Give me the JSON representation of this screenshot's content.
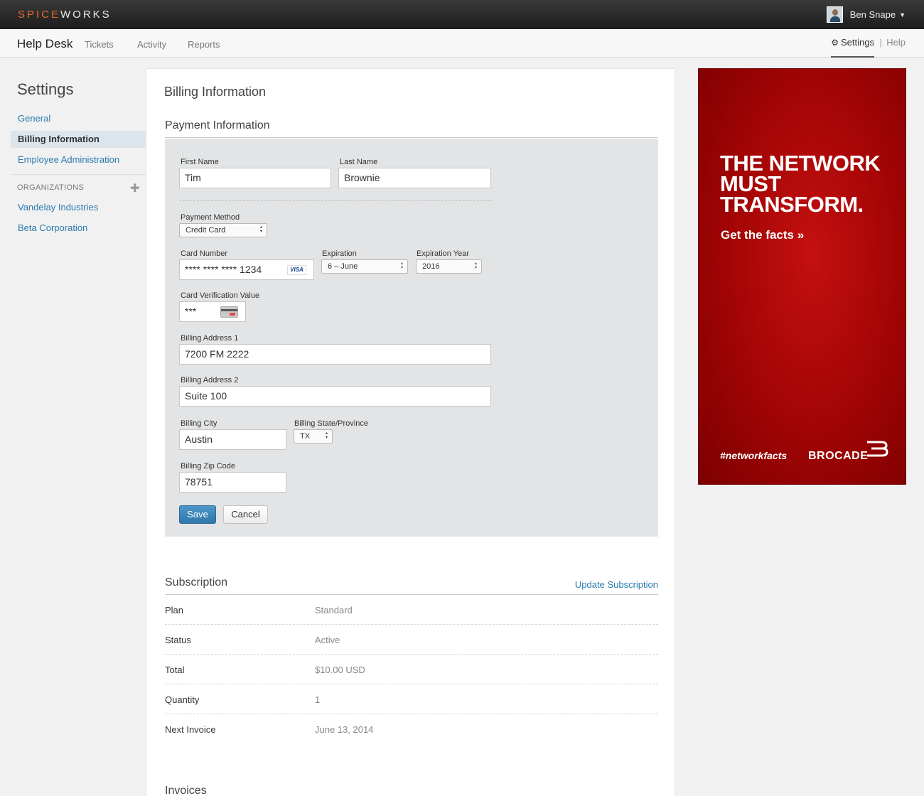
{
  "topbar": {
    "logo_part1": "SPICE",
    "logo_part2": "WORKS",
    "user_name": "Ben Snape"
  },
  "subnav": {
    "brand": "Help Desk",
    "links": [
      "Tickets",
      "Activity",
      "Reports"
    ],
    "settings_label": "Settings",
    "separator": "|",
    "help_label": "Help"
  },
  "sidebar": {
    "title": "Settings",
    "items": [
      "General",
      "Billing Information",
      "Employee Administration"
    ],
    "active_item": "Billing Information",
    "orgs_label": "ORGANIZATIONS",
    "orgs": [
      "Vandelay Industries",
      "Beta Corporation"
    ]
  },
  "main": {
    "title": "Billing Information",
    "payment": {
      "title": "Payment Information",
      "first_name_label": "First Name",
      "first_name": "Tim",
      "last_name_label": "Last Name",
      "last_name": "Brownie",
      "method_label": "Payment Method",
      "method": "Credit Card",
      "card_number_label": "Card Number",
      "card_number": "**** **** **** 1234",
      "card_brand": "VISA",
      "expiration_label": "Expiration",
      "expiration": "6 – June",
      "exp_year_label": "Expiration Year",
      "exp_year": "2016",
      "cvv_label": "Card Verification Value",
      "cvv": "***",
      "address1_label": "Billing Address 1",
      "address1": "7200 FM 2222",
      "address2_label": "Billing Address 2",
      "address2": "Suite 100",
      "city_label": "Billing City",
      "city": "Austin",
      "state_label": "Billing State/Province",
      "state": "TX",
      "zip_label": "Billing Zip Code",
      "zip": "78751",
      "save_label": "Save",
      "cancel_label": "Cancel"
    },
    "subscription": {
      "title": "Subscription",
      "update_label": "Update Subscription",
      "rows": [
        {
          "key": "Plan",
          "value": "Standard"
        },
        {
          "key": "Status",
          "value": "Active"
        },
        {
          "key": "Total",
          "value": "$10.00 USD"
        },
        {
          "key": "Quantity",
          "value": "1"
        },
        {
          "key": "Next Invoice",
          "value": "June 13, 2014"
        }
      ]
    },
    "invoices_title": "Invoices"
  },
  "ad": {
    "headline_1": "THE NETWORK",
    "headline_2": "MUST",
    "headline_3": "TRANSFORM.",
    "cta": "Get the facts »",
    "hashtag": "#networkfacts",
    "brand": "BROCADE"
  }
}
